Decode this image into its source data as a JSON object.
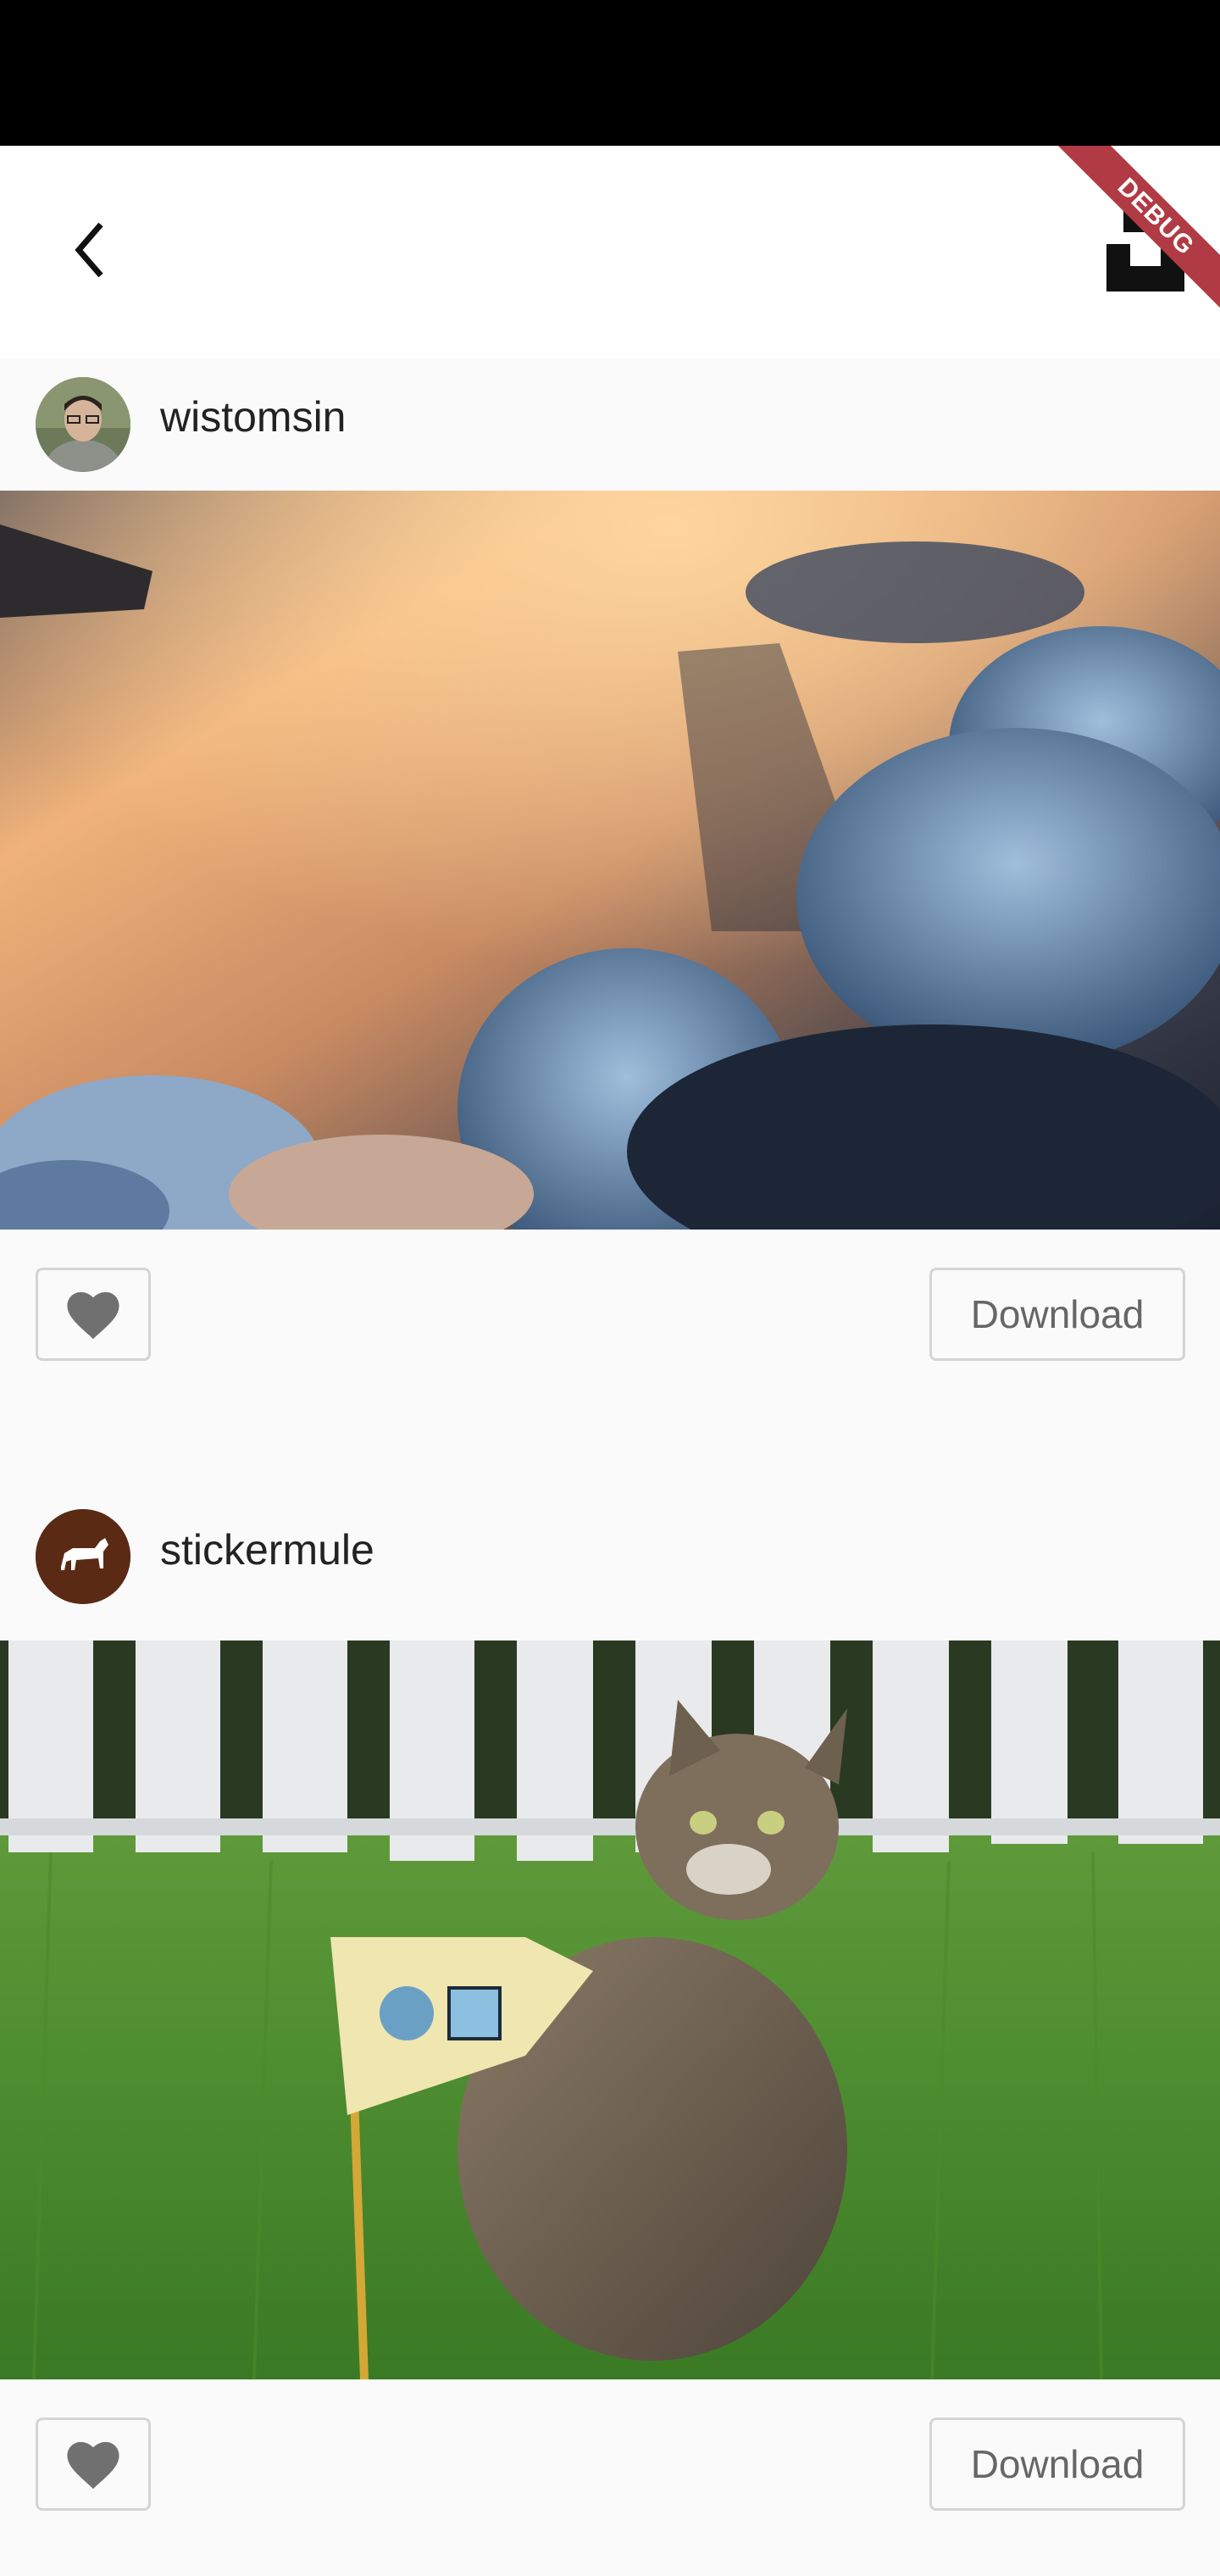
{
  "app": {
    "debug_label": "DEBUG",
    "icons": {
      "back": "back-arrow-icon",
      "logo": "unsplash-logo-icon",
      "like": "heart-icon"
    }
  },
  "colors": {
    "accent_debug": "#b13b44",
    "button_border": "#d4d4d4",
    "button_text": "#666666"
  },
  "posts": [
    {
      "username": "wistomsin",
      "photo_desc": "sunset above clouds from airplane window",
      "download_label": "Download"
    },
    {
      "username": "stickermule",
      "photo_desc": "tabby cat in grass with flag",
      "download_label": "Download"
    }
  ]
}
